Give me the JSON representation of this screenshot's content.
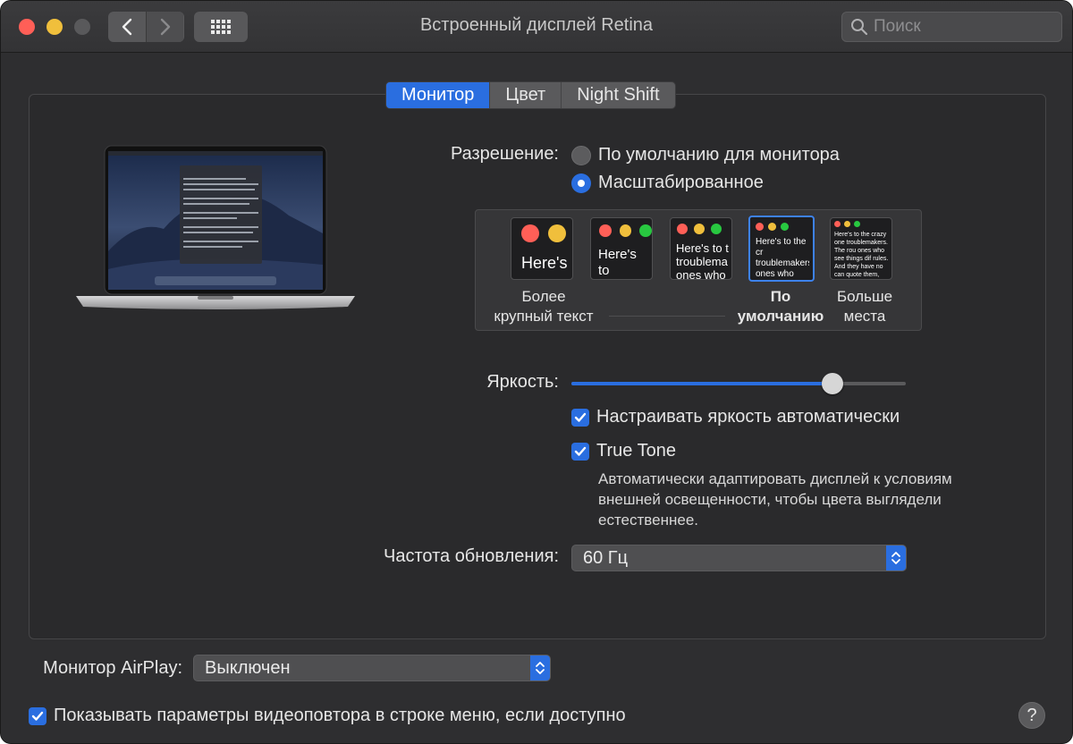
{
  "window": {
    "title": "Встроенный дисплей Retina"
  },
  "search": {
    "placeholder": "Поиск"
  },
  "tabs": [
    {
      "label": "Монитор",
      "active": true
    },
    {
      "label": "Цвет",
      "active": false
    },
    {
      "label": "Night Shift",
      "active": false
    }
  ],
  "resolution": {
    "label": "Разрешение:",
    "options": [
      {
        "label": "По умолчанию для монитора",
        "selected": false
      },
      {
        "label": "Масштабированное",
        "selected": true
      }
    ]
  },
  "scale_options": [
    {
      "sample": "Here's",
      "caption_line1": "Более",
      "caption_line2": "крупный текст",
      "selected": false
    },
    {
      "sample": "Here's to troublem",
      "caption_line1": "",
      "caption_line2": "",
      "selected": false
    },
    {
      "sample": "Here's to t troublema ones who",
      "caption_line1": "",
      "caption_line2": "",
      "selected": false
    },
    {
      "sample": "Here's to the cr troublemakers. ones who see t rules. And they",
      "caption_line1": "По",
      "caption_line2": "умолчанию",
      "selected": true
    },
    {
      "sample": "Here's to the crazy one troublemakers. The rou ones who see things dif rules. And they have no can quote them, disagre them. About the only th Because they change th",
      "caption_line1": "Больше",
      "caption_line2": "места",
      "selected": false
    }
  ],
  "brightness": {
    "label": "Яркость:",
    "level": 0.78
  },
  "auto_brightness": {
    "label": "Настраивать яркость автоматически",
    "checked": true
  },
  "true_tone": {
    "label": "True Tone",
    "checked": true,
    "description": "Автоматически адаптировать дисплей к условиям внешней освещенности, чтобы цвета выглядели естественнее."
  },
  "refresh_rate": {
    "label": "Частота обновления:",
    "value": "60 Гц"
  },
  "airplay": {
    "label": "Монитор AirPlay:",
    "value": "Выключен"
  },
  "mirroring_option": {
    "label": "Показывать параметры видеоповтора в строке меню, если доступно",
    "checked": true
  },
  "help": {
    "label": "?"
  },
  "colors": {
    "accent": "#2a6ee0",
    "window_bg": "#2e2e30",
    "red": "#ff5f57",
    "yellow": "#f0bf3c",
    "green": "#28c840"
  }
}
